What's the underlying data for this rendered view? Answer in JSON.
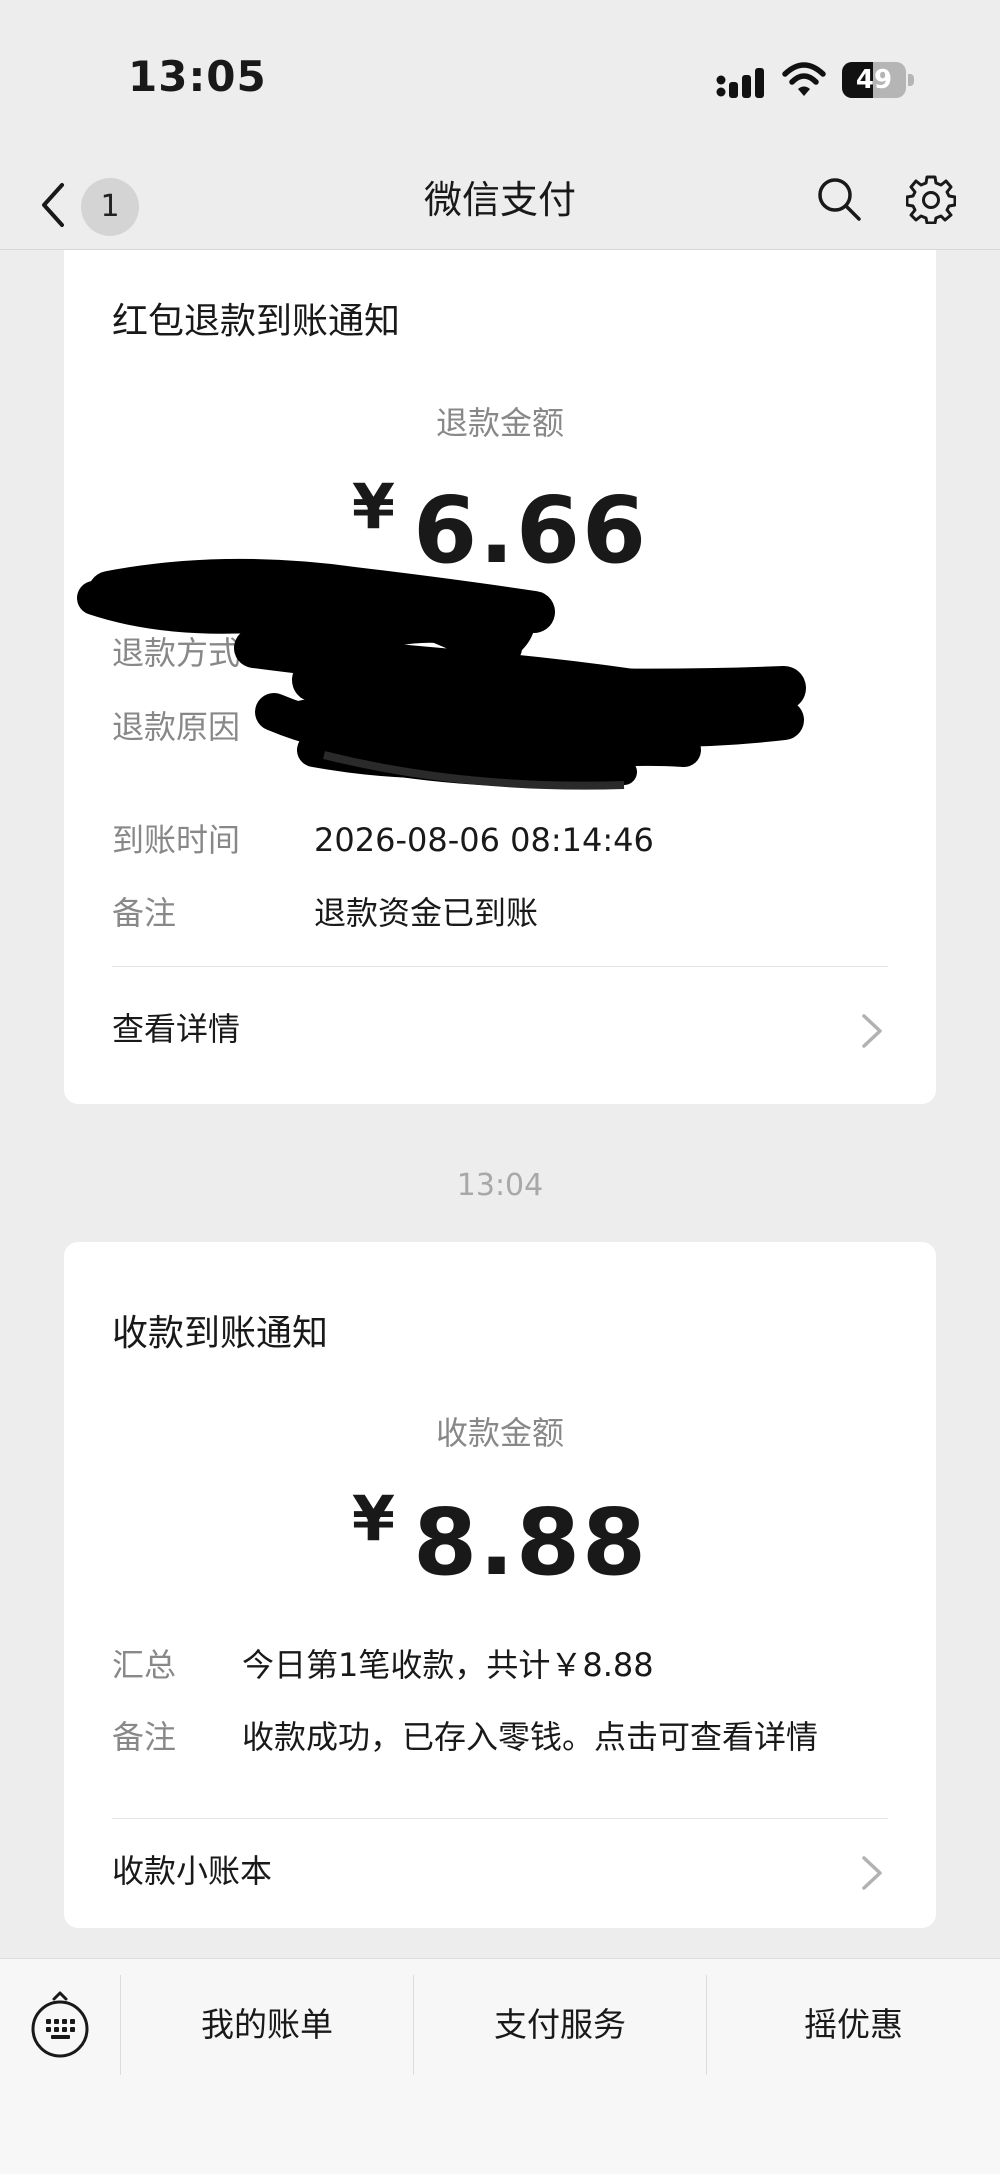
{
  "status_bar": {
    "time": "13:05",
    "battery": "49",
    "battery_level": 0.49
  },
  "nav": {
    "back_badge": "1",
    "title": "微信支付"
  },
  "refund_card": {
    "title": "红包退款到账通知",
    "amount_label": "退款金额",
    "currency": "¥",
    "amount": "6.66",
    "rows": [
      {
        "label": "退款方式",
        "value": ""
      },
      {
        "label": "退款原因",
        "value": ""
      },
      {
        "label": "到账时间",
        "value": "2026-08-06 08:14:46"
      },
      {
        "label": "备注",
        "value": "退款资金已到账"
      }
    ],
    "link_label": "查看详情"
  },
  "message_time": "13:04",
  "income_card": {
    "title": "收款到账通知",
    "amount_label": "收款金额",
    "currency": "¥",
    "amount": "8.88",
    "rows": [
      {
        "label": "汇总",
        "value": "今日第1笔收款，共计￥8.88"
      },
      {
        "label": "备注",
        "value": "收款成功，已存入零钱。点击可查看详情"
      }
    ],
    "link_label": "收款小账本"
  },
  "bottom_menu": {
    "items": [
      "我的账单",
      "支付服务",
      "摇优惠"
    ]
  },
  "icons": {
    "back": "chevron-left-icon",
    "search": "search-icon",
    "settings": "gear-icon",
    "keyboard": "keyboard-icon",
    "link": "chevron-right-icon"
  },
  "colors": {
    "background": "#ededed",
    "card": "#ffffff",
    "secondary_text": "#888888"
  }
}
